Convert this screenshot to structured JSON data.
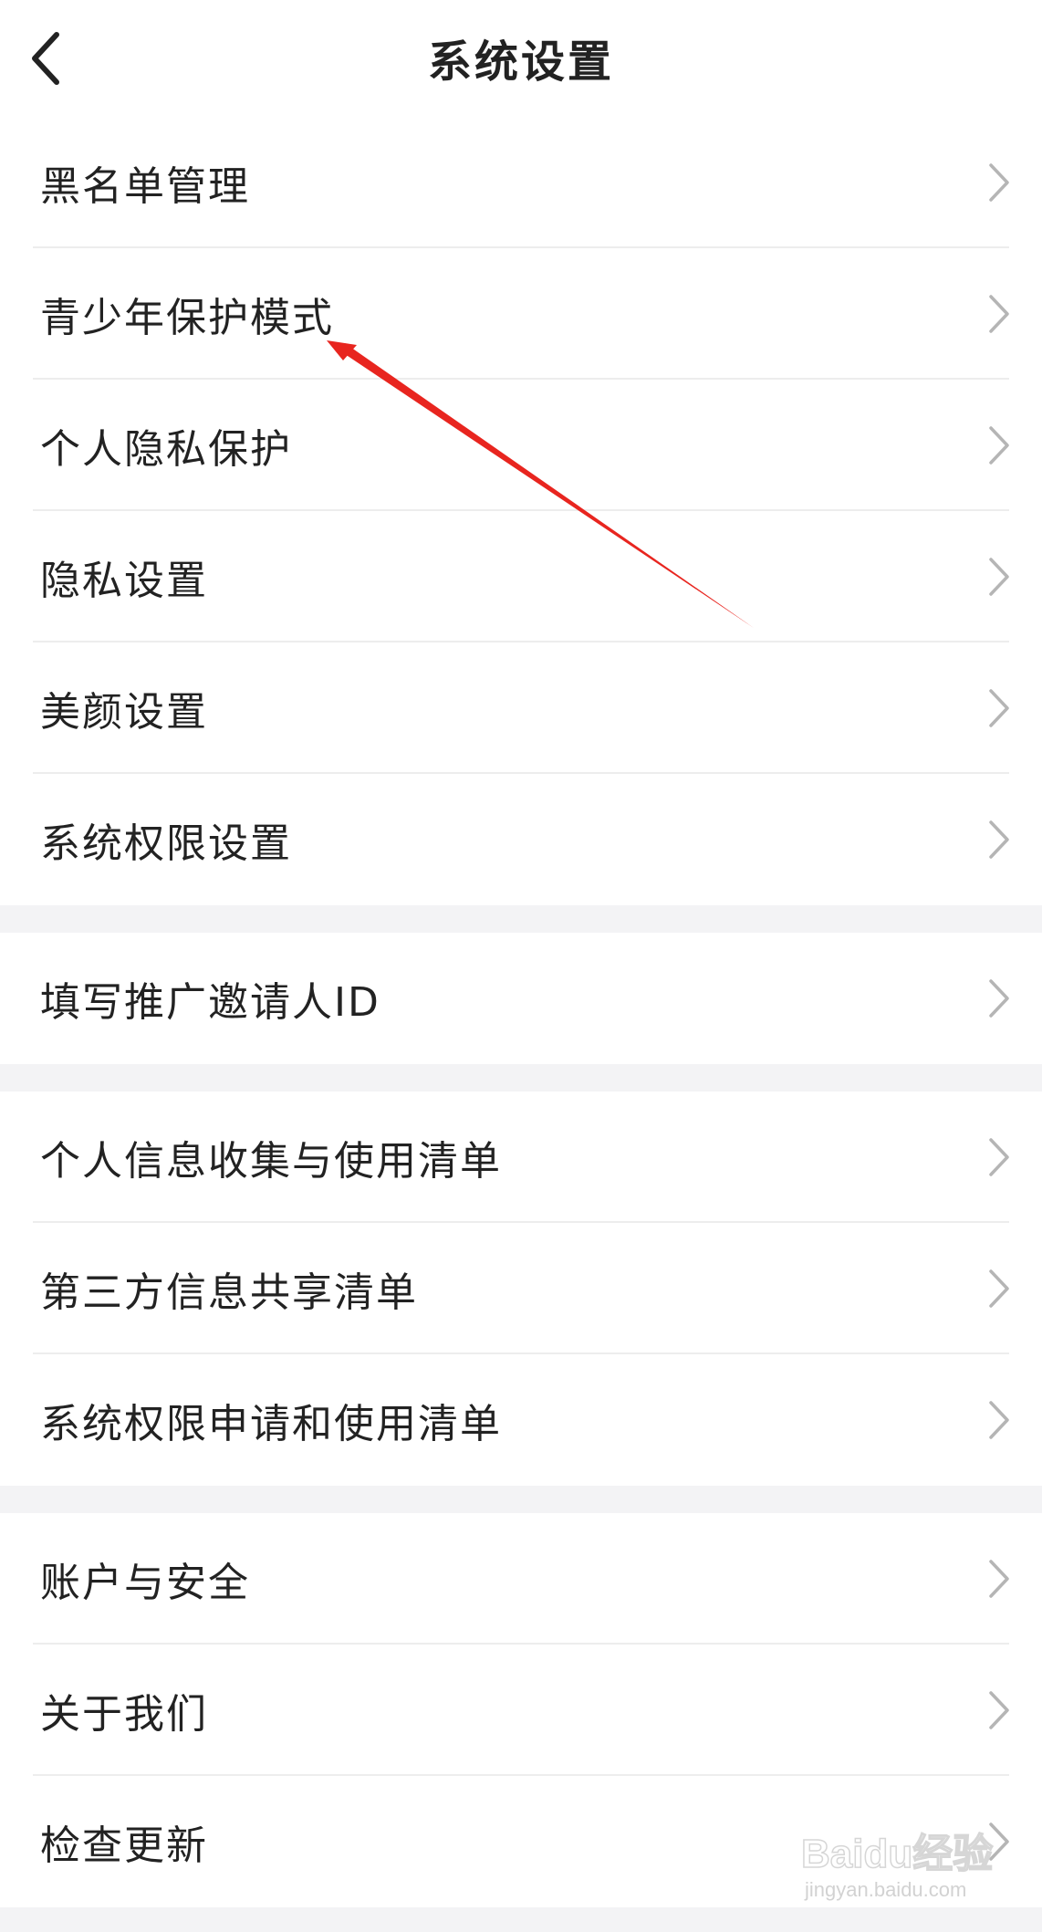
{
  "header": {
    "title": "系统设置",
    "back_icon": "chevron-left-icon"
  },
  "groups": [
    {
      "items": [
        {
          "label": "黑名单管理"
        },
        {
          "label": "青少年保护模式"
        },
        {
          "label": "个人隐私保护"
        },
        {
          "label": "隐私设置"
        },
        {
          "label": "美颜设置"
        },
        {
          "label": "系统权限设置"
        }
      ]
    },
    {
      "items": [
        {
          "label": "填写推广邀请人ID"
        }
      ]
    },
    {
      "items": [
        {
          "label": "个人信息收集与使用清单"
        },
        {
          "label": "第三方信息共享清单"
        },
        {
          "label": "系统权限申请和使用清单"
        }
      ]
    },
    {
      "items": [
        {
          "label": "账户与安全"
        },
        {
          "label": "关于我们"
        },
        {
          "label": "检查更新"
        }
      ]
    }
  ],
  "watermark": {
    "brand": "Baidu经验",
    "url": "jingyan.baidu.com"
  },
  "colors": {
    "background": "#ffffff",
    "section_gap": "#f3f3f5",
    "text": "#222222",
    "chevron": "#b5b5b5",
    "annotation_arrow": "#e8251f"
  },
  "icons": {
    "row_chevron": "chevron-right-icon",
    "annotation": "red-arrow-annotation"
  }
}
